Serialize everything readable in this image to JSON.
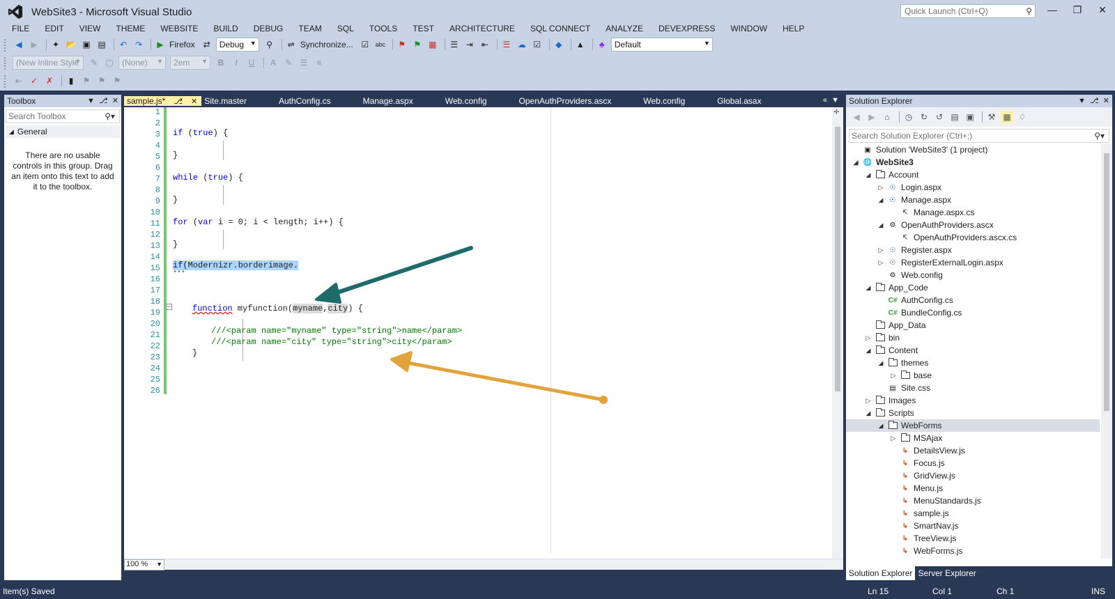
{
  "window": {
    "title": "WebSite3 - Microsoft Visual Studio",
    "quick_launch_placeholder": "Quick Launch (Ctrl+Q)"
  },
  "menu": [
    "FILE",
    "EDIT",
    "VIEW",
    "THEME",
    "WEBSITE",
    "BUILD",
    "DEBUG",
    "TEAM",
    "SQL",
    "TOOLS",
    "TEST",
    "ARCHITECTURE",
    "SQL CONNECT",
    "ANALYZE",
    "DEVEXPRESS",
    "WINDOW",
    "HELP"
  ],
  "toolbar": {
    "browser": "Firefox",
    "config": "Debug",
    "sync": "Synchronize...",
    "layout": "Default",
    "style_combo": "(New Inline Style",
    "target_combo": "(None)",
    "size_combo": "2em"
  },
  "toolbox": {
    "title": "Toolbox",
    "search_placeholder": "Search Toolbox",
    "group": "General",
    "empty_text": "There are no usable controls in this group. Drag an item onto this text to add it to the toolbox."
  },
  "tabs": [
    "sample.js*",
    "Site.master",
    "AuthConfig.cs",
    "Manage.aspx",
    "Web.config",
    "OpenAuthProviders.ascx",
    "Web.config",
    "Global.asax"
  ],
  "editor": {
    "line_numbers": [
      "1",
      "2",
      "3",
      "4",
      "5",
      "6",
      "7",
      "8",
      "9",
      "10",
      "11",
      "12",
      "13",
      "14",
      "15",
      "16",
      "17",
      "18",
      "19",
      "20",
      "21",
      "22",
      "23",
      "24",
      "25",
      "26"
    ],
    "zoom": "100 %",
    "lines": {
      "l3a": "if",
      "l3b": " (",
      "l3c": "true",
      "l3d": ") {",
      "l5": "}",
      "l7a": "while",
      "l7b": " (",
      "l7c": "true",
      "l7d": ") {",
      "l9": "}",
      "l11a": "for",
      "l11b": " (",
      "l11c": "var",
      "l11d": " i = 0; i < length; i++) {",
      "l13": "}",
      "l15a": "if",
      "l15b": "(Modernizr.borderimage.",
      "l16": "•••",
      "l19a": "function",
      "l19b": " myfunction(",
      "l19c": "myname",
      "l19d": ",",
      "l19e": "city",
      "l19f": ") {",
      "l21": "///<param name=\"myname\" type=\"string\">name</param>",
      "l22": "///<param name=\"city\" type=\"string\">city</param>",
      "l23": "}"
    }
  },
  "solution_explorer": {
    "title": "Solution Explorer",
    "search_placeholder": "Search Solution Explorer (Ctrl+;)",
    "items": [
      {
        "label": "Solution 'WebSite3' (1 project)"
      },
      {
        "label": "WebSite3"
      },
      {
        "label": "Account"
      },
      {
        "label": "Login.aspx"
      },
      {
        "label": "Manage.aspx"
      },
      {
        "label": "Manage.aspx.cs"
      },
      {
        "label": "OpenAuthProviders.ascx"
      },
      {
        "label": "OpenAuthProviders.ascx.cs"
      },
      {
        "label": "Register.aspx"
      },
      {
        "label": "RegisterExternalLogin.aspx"
      },
      {
        "label": "Web.config"
      },
      {
        "label": "App_Code"
      },
      {
        "label": "AuthConfig.cs"
      },
      {
        "label": "BundleConfig.cs"
      },
      {
        "label": "App_Data"
      },
      {
        "label": "bin"
      },
      {
        "label": "Content"
      },
      {
        "label": "themes"
      },
      {
        "label": "base"
      },
      {
        "label": "Site.css"
      },
      {
        "label": "Images"
      },
      {
        "label": "Scripts"
      },
      {
        "label": "WebForms"
      },
      {
        "label": "MSAjax"
      },
      {
        "label": "DetailsView.js"
      },
      {
        "label": "Focus.js"
      },
      {
        "label": "GridView.js"
      },
      {
        "label": "Menu.js"
      },
      {
        "label": "MenuStandards.js"
      },
      {
        "label": "sample.js"
      },
      {
        "label": "SmartNav.js"
      },
      {
        "label": "TreeView.js"
      },
      {
        "label": "WebForms.js"
      }
    ],
    "bottom_tabs": [
      "Solution Explorer",
      "Server Explorer"
    ]
  },
  "status": {
    "message": "Item(s) Saved",
    "line": "Ln 15",
    "col": "Col 1",
    "ch": "Ch 1",
    "mode": "INS"
  },
  "colors": {
    "chrome": "#c8d4e6",
    "dark": "#293955",
    "active_tab": "#fff1a8",
    "arrow_teal": "#1f6b6b",
    "arrow_gold": "#e2a33a"
  }
}
